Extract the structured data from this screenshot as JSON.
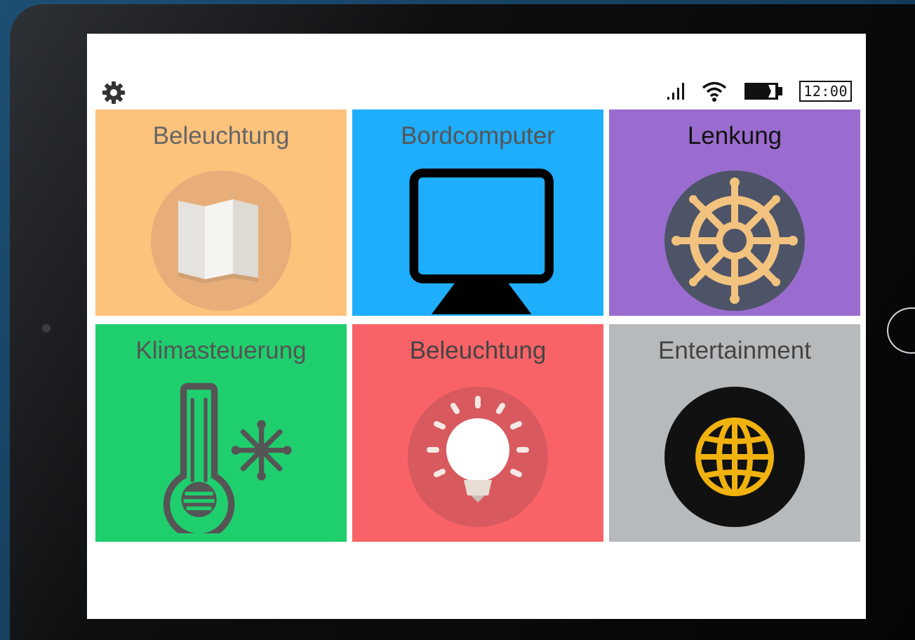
{
  "status_bar": {
    "settings_icon": "gear-icon",
    "signal_icon": "signal-icon",
    "wifi_icon": "wifi-icon",
    "battery_icon": "battery-icon",
    "clock": "12:00"
  },
  "tiles": [
    {
      "label": "Beleuchtung",
      "icon": "map-icon",
      "color": "#fdc27c",
      "label_color": "#666666"
    },
    {
      "label": "Bordcomputer",
      "icon": "monitor-icon",
      "color": "#1eaefc",
      "label_color": "#555555"
    },
    {
      "label": "Lenkung",
      "icon": "steering-wheel-icon",
      "color": "#9b6ccf",
      "label_color": "#111111"
    },
    {
      "label": "Klimasteuerung",
      "icon": "thermometer-snowflake-icon",
      "color": "#1fcf6e",
      "label_color": "#555555"
    },
    {
      "label": "Beleuchtung",
      "icon": "light-bulb-icon",
      "color": "#f96367",
      "label_color": "#444444"
    },
    {
      "label": "Entertainment",
      "icon": "globe-icon",
      "color": "#b7babd",
      "label_color": "#444444"
    }
  ]
}
